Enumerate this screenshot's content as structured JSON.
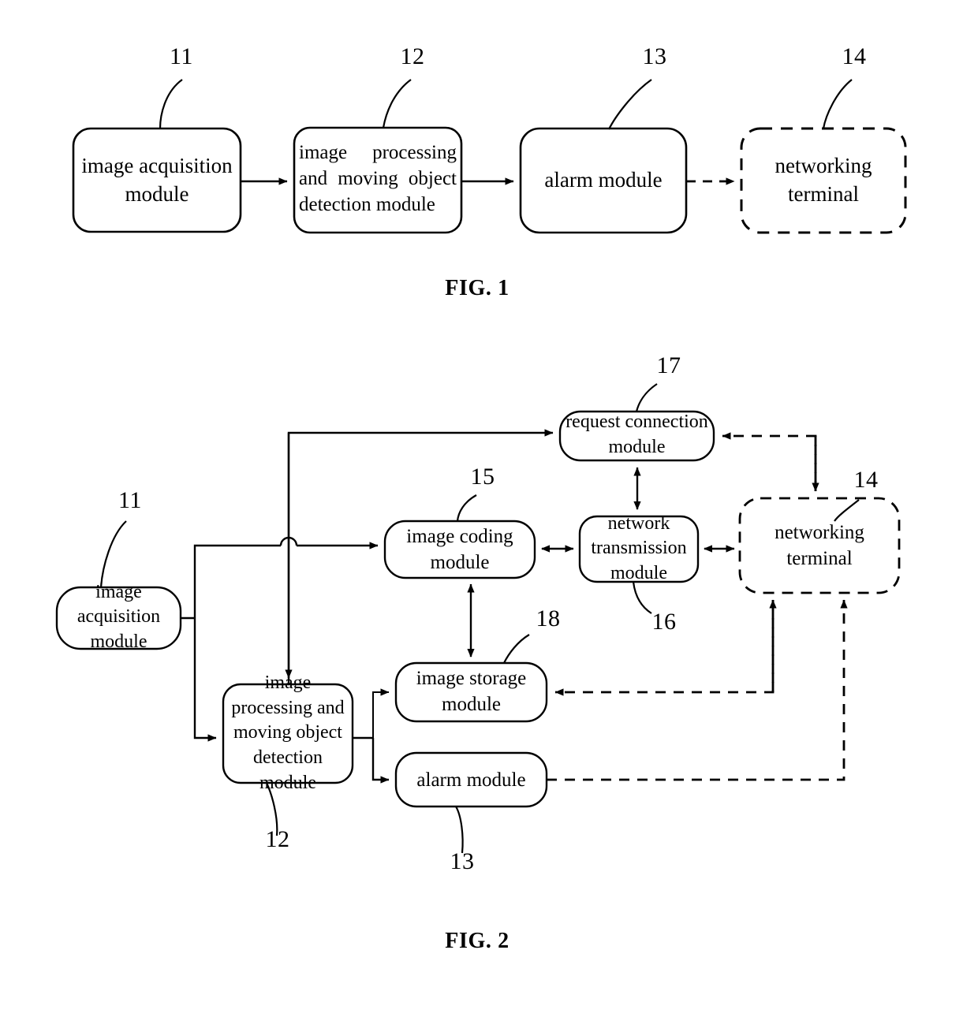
{
  "figures": [
    {
      "id": "fig1",
      "caption": "FIG. 1",
      "nodes": [
        {
          "key": "image_acquisition_module",
          "label": "image acquisition module",
          "ref": "11",
          "style": "solid"
        },
        {
          "key": "image_processing_module",
          "label": "image processing and moving object detection module",
          "ref": "12",
          "style": "solid"
        },
        {
          "key": "alarm_module",
          "label": "alarm module",
          "ref": "13",
          "style": "solid"
        },
        {
          "key": "networking_terminal",
          "label": "networking terminal",
          "ref": "14",
          "style": "dashed"
        }
      ],
      "connections": [
        {
          "from": "image_acquisition_module",
          "to": "image_processing_module",
          "style": "solid",
          "direction": "forward"
        },
        {
          "from": "image_processing_module",
          "to": "alarm_module",
          "style": "solid",
          "direction": "forward"
        },
        {
          "from": "alarm_module",
          "to": "networking_terminal",
          "style": "dashed",
          "direction": "forward"
        }
      ]
    },
    {
      "id": "fig2",
      "caption": "FIG. 2",
      "nodes": [
        {
          "key": "image_acquisition_module",
          "label": "image acquisition module",
          "ref": "11",
          "style": "solid"
        },
        {
          "key": "image_processing_module",
          "label": "image processing and moving object detection module",
          "ref": "12",
          "style": "solid"
        },
        {
          "key": "alarm_module",
          "label": "alarm module",
          "ref": "13",
          "style": "solid"
        },
        {
          "key": "networking_terminal",
          "label": "networking terminal",
          "ref": "14",
          "style": "dashed"
        },
        {
          "key": "image_coding_module",
          "label": "image coding module",
          "ref": "15",
          "style": "solid"
        },
        {
          "key": "network_transmission_module",
          "label": "network transmission module",
          "ref": "16",
          "style": "solid"
        },
        {
          "key": "request_connection_module",
          "label": "request connection module",
          "ref": "17",
          "style": "solid"
        },
        {
          "key": "image_storage_module",
          "label": "image storage module",
          "ref": "18",
          "style": "solid"
        }
      ],
      "connections": [
        {
          "from": "image_acquisition_module",
          "to": "image_coding_module",
          "style": "solid",
          "direction": "forward"
        },
        {
          "from": "image_acquisition_module",
          "to": "image_processing_module",
          "style": "solid",
          "direction": "forward"
        },
        {
          "from": "image_acquisition_module",
          "to": "request_connection_module",
          "style": "solid",
          "direction": "forward"
        },
        {
          "from": "image_coding_module",
          "to": "network_transmission_module",
          "style": "solid",
          "direction": "both"
        },
        {
          "from": "network_transmission_module",
          "to": "request_connection_module",
          "style": "solid",
          "direction": "both"
        },
        {
          "from": "network_transmission_module",
          "to": "networking_terminal",
          "style": "solid",
          "direction": "both"
        },
        {
          "from": "image_coding_module",
          "to": "image_storage_module",
          "style": "solid",
          "direction": "both"
        },
        {
          "from": "image_processing_module",
          "to": "image_storage_module",
          "style": "solid",
          "direction": "forward"
        },
        {
          "from": "image_processing_module",
          "to": "alarm_module",
          "style": "solid",
          "direction": "forward"
        },
        {
          "from": "networking_terminal",
          "to": "request_connection_module",
          "style": "dashed",
          "direction": "forward"
        },
        {
          "from": "networking_terminal",
          "to": "image_storage_module",
          "style": "dashed",
          "direction": "forward"
        },
        {
          "from": "alarm_module",
          "to": "networking_terminal",
          "style": "dashed",
          "direction": "forward"
        }
      ]
    }
  ],
  "fig1": {
    "caption": "FIG. 1",
    "box_11": {
      "line1": "image acquisition",
      "line2": "module"
    },
    "box_12": {
      "line1": "image processing",
      "line2": "and moving object",
      "line3": "detection module"
    },
    "box_13": {
      "line1": "alarm module"
    },
    "box_14": {
      "line1": "networking",
      "line2": "terminal"
    },
    "ref_11": "11",
    "ref_12": "12",
    "ref_13": "13",
    "ref_14": "14"
  },
  "fig2": {
    "caption": "FIG. 2",
    "box_11": {
      "line1": "image",
      "line2": "acquisition",
      "line3": "module"
    },
    "box_12": {
      "line1": "image",
      "line2": "processing and",
      "line3": "moving object",
      "line4": "detection",
      "line5": "module"
    },
    "box_13": {
      "line1": "alarm module"
    },
    "box_14": {
      "line1": "networking",
      "line2": "terminal"
    },
    "box_15": {
      "line1": "image coding",
      "line2": "module"
    },
    "box_16": {
      "line1": "network",
      "line2": "transmission",
      "line3": "module"
    },
    "box_17": {
      "line1": "request connection",
      "line2": "module"
    },
    "box_18": {
      "line1": "image storage",
      "line2": "module"
    },
    "ref_11": "11",
    "ref_12": "12",
    "ref_13": "13",
    "ref_14": "14",
    "ref_15": "15",
    "ref_16": "16",
    "ref_17": "17",
    "ref_18": "18"
  },
  "colors": {
    "stroke": "#000000",
    "background": "#ffffff"
  }
}
